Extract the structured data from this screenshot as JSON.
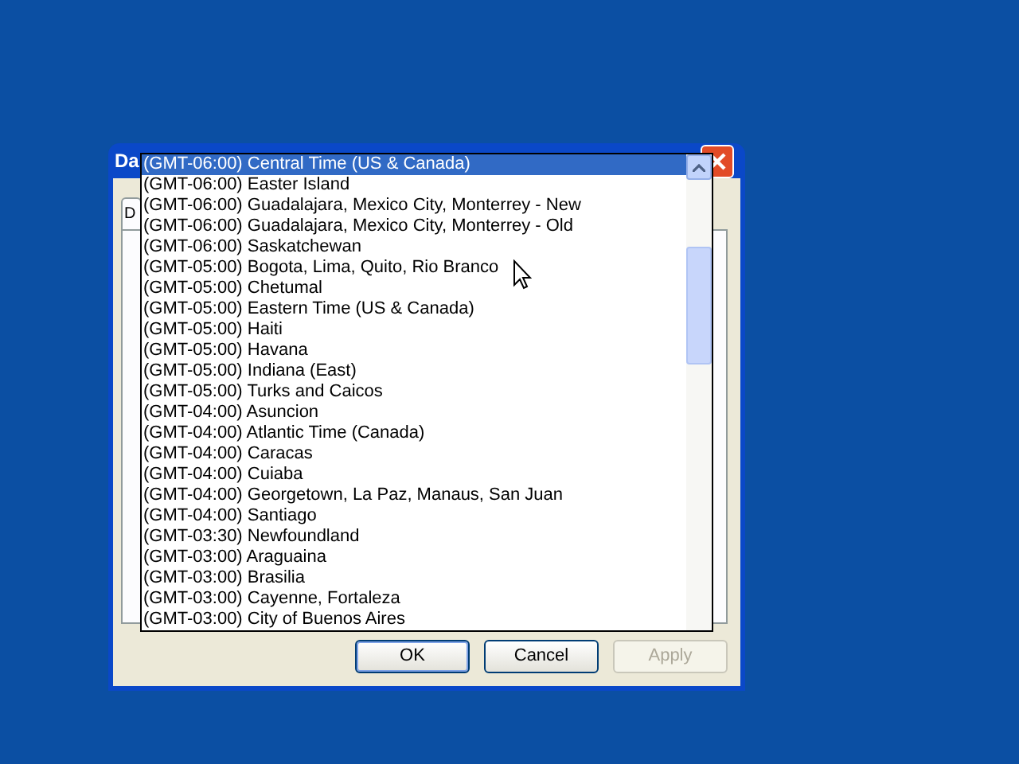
{
  "window": {
    "title": "Da"
  },
  "tabs": [
    {
      "label": "D",
      "selected": true
    }
  ],
  "timezone_list": {
    "items": [
      {
        "label": "(GMT-06:00) Central Time (US & Canada)",
        "selected": true
      },
      {
        "label": "(GMT-06:00) Easter Island",
        "selected": false
      },
      {
        "label": "(GMT-06:00) Guadalajara, Mexico City, Monterrey - New",
        "selected": false
      },
      {
        "label": "(GMT-06:00) Guadalajara, Mexico City, Monterrey - Old",
        "selected": false
      },
      {
        "label": "(GMT-06:00) Saskatchewan",
        "selected": false
      },
      {
        "label": "(GMT-05:00) Bogota, Lima, Quito, Rio Branco",
        "selected": false
      },
      {
        "label": "(GMT-05:00) Chetumal",
        "selected": false
      },
      {
        "label": "(GMT-05:00) Eastern Time (US & Canada)",
        "selected": false
      },
      {
        "label": "(GMT-05:00) Haiti",
        "selected": false
      },
      {
        "label": "(GMT-05:00) Havana",
        "selected": false
      },
      {
        "label": "(GMT-05:00) Indiana (East)",
        "selected": false
      },
      {
        "label": "(GMT-05:00) Turks and Caicos",
        "selected": false
      },
      {
        "label": "(GMT-04:00) Asuncion",
        "selected": false
      },
      {
        "label": "(GMT-04:00) Atlantic Time (Canada)",
        "selected": false
      },
      {
        "label": "(GMT-04:00) Caracas",
        "selected": false
      },
      {
        "label": "(GMT-04:00) Cuiaba",
        "selected": false
      },
      {
        "label": "(GMT-04:00) Georgetown, La Paz, Manaus, San Juan",
        "selected": false
      },
      {
        "label": "(GMT-04:00) Santiago",
        "selected": false
      },
      {
        "label": "(GMT-03:30) Newfoundland",
        "selected": false
      },
      {
        "label": "(GMT-03:00) Araguaina",
        "selected": false
      },
      {
        "label": "(GMT-03:00) Brasilia",
        "selected": false
      },
      {
        "label": "(GMT-03:00) Cayenne, Fortaleza",
        "selected": false
      },
      {
        "label": "(GMT-03:00) City of Buenos Aires",
        "selected": false
      }
    ]
  },
  "buttons": [
    {
      "label": "OK",
      "disabled": false,
      "default": true
    },
    {
      "label": "Cancel",
      "disabled": false,
      "default": false
    },
    {
      "label": "Apply",
      "disabled": true,
      "default": false
    }
  ]
}
